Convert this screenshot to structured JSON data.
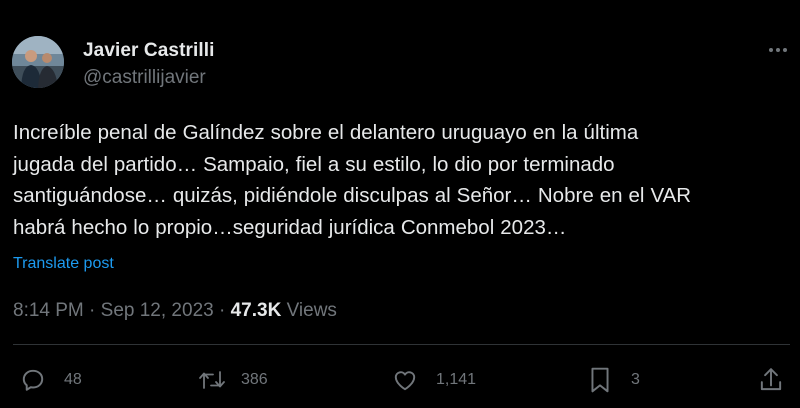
{
  "author": {
    "display_name": "Javier Castrilli",
    "handle": "@castrillijavier"
  },
  "tweet": {
    "text": "Increíble penal de Galíndez sobre el delantero uruguayo en la última\njugada del partido… Sampaio, fiel a su estilo, lo dio por terminado\nsantiguándose… quizás, pidiéndole disculpas al Señor… Nobre en el VAR\nhabrá hecho lo propio…seguridad jurídica Conmebol 2023…",
    "translate_label": "Translate post",
    "time": "8:14 PM",
    "separator": " · ",
    "date": "Sep 12, 2023",
    "views_count": "47.3K",
    "views_label": " Views"
  },
  "actions": {
    "replies": "48",
    "reposts": "386",
    "likes": "1,141",
    "bookmarks": "3"
  },
  "colors": {
    "background": "#000000",
    "text": "#e7e9ea",
    "secondary": "#71767b",
    "link": "#1d9bf0",
    "divider": "#2f3336"
  },
  "icons": [
    "more-icon",
    "reply-icon",
    "repost-icon",
    "like-icon",
    "bookmark-icon",
    "share-icon"
  ]
}
